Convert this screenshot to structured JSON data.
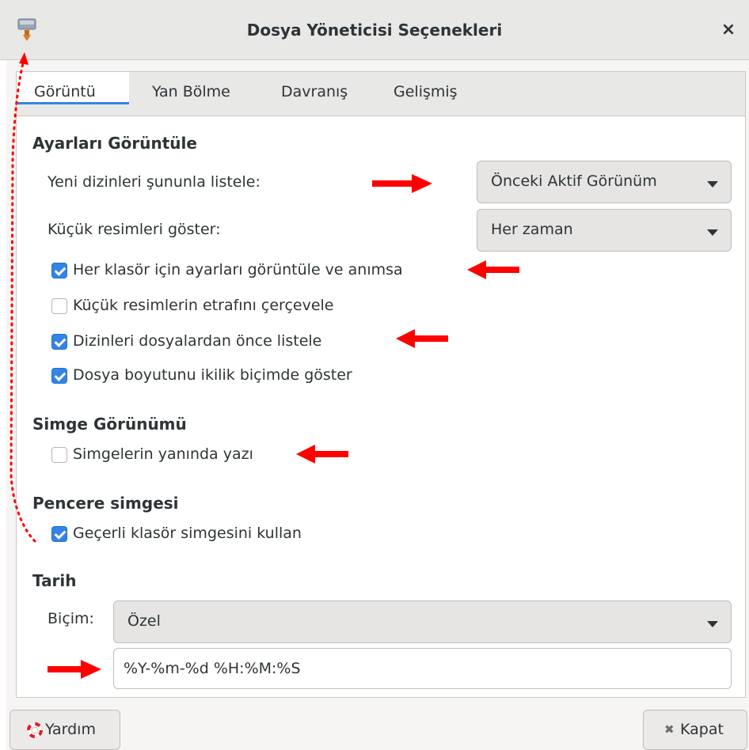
{
  "window": {
    "title": "Dosya Yöneticisi Seçenekleri",
    "close_glyph": "×",
    "app_icon": "file-manager-icon"
  },
  "tabs": [
    {
      "label": "Görüntü",
      "active": true
    },
    {
      "label": "Yan Bölme",
      "active": false
    },
    {
      "label": "Davranış",
      "active": false
    },
    {
      "label": "Gelişmiş",
      "active": false
    }
  ],
  "display_settings": {
    "heading": "Ayarları Görüntüle",
    "view_new_folders_label": "Yeni dizinleri şununla listele:",
    "view_new_folders_value": "Önceki Aktif Görünüm",
    "thumbnails_label": "Küçük resimleri göster:",
    "thumbnails_value": "Her zaman",
    "checks": [
      {
        "label": "Her klasör için ayarları görüntüle ve anımsa",
        "checked": true
      },
      {
        "label": "Küçük resimlerin etrafını çerçevele",
        "checked": false
      },
      {
        "label": "Dizinleri dosyalardan önce listele",
        "checked": true
      },
      {
        "label": "Dosya boyutunu ikilik biçimde göster",
        "checked": true
      }
    ]
  },
  "icon_view": {
    "heading": "Simge Görünümü",
    "text_beside_icons": {
      "label": "Simgelerin yanında yazı",
      "checked": false
    }
  },
  "window_icon": {
    "heading": "Pencere simgesi",
    "use_current_folder_icon": {
      "label": "Geçerli klasör simgesini kullan",
      "checked": true
    }
  },
  "date": {
    "heading": "Tarih",
    "format_label": "Biçim:",
    "format_value": "Özel",
    "custom_format": "%Y-%m-%d %H:%M:%S"
  },
  "buttons": {
    "help_label": "Yardım",
    "close_label": "Kapat",
    "help_icon": "lifebuoy-icon",
    "close_icon": "close-icon",
    "close_glyph": "✖"
  },
  "colors": {
    "accent": "#3584e4",
    "annotation_arrow": "#ff0000"
  }
}
